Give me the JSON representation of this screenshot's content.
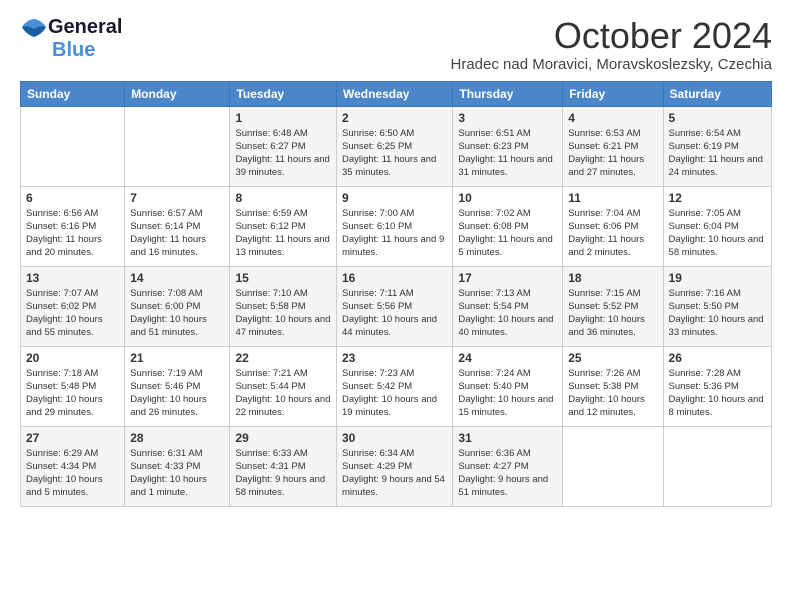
{
  "logo": {
    "line1": "General",
    "line2": "Blue"
  },
  "title": "October 2024",
  "subtitle": "Hradec nad Moravici, Moravskoslezsky, Czechia",
  "headers": [
    "Sunday",
    "Monday",
    "Tuesday",
    "Wednesday",
    "Thursday",
    "Friday",
    "Saturday"
  ],
  "weeks": [
    [
      {
        "day": "",
        "info": ""
      },
      {
        "day": "",
        "info": ""
      },
      {
        "day": "1",
        "info": "Sunrise: 6:48 AM\nSunset: 6:27 PM\nDaylight: 11 hours and 39 minutes."
      },
      {
        "day": "2",
        "info": "Sunrise: 6:50 AM\nSunset: 6:25 PM\nDaylight: 11 hours and 35 minutes."
      },
      {
        "day": "3",
        "info": "Sunrise: 6:51 AM\nSunset: 6:23 PM\nDaylight: 11 hours and 31 minutes."
      },
      {
        "day": "4",
        "info": "Sunrise: 6:53 AM\nSunset: 6:21 PM\nDaylight: 11 hours and 27 minutes."
      },
      {
        "day": "5",
        "info": "Sunrise: 6:54 AM\nSunset: 6:19 PM\nDaylight: 11 hours and 24 minutes."
      }
    ],
    [
      {
        "day": "6",
        "info": "Sunrise: 6:56 AM\nSunset: 6:16 PM\nDaylight: 11 hours and 20 minutes."
      },
      {
        "day": "7",
        "info": "Sunrise: 6:57 AM\nSunset: 6:14 PM\nDaylight: 11 hours and 16 minutes."
      },
      {
        "day": "8",
        "info": "Sunrise: 6:59 AM\nSunset: 6:12 PM\nDaylight: 11 hours and 13 minutes."
      },
      {
        "day": "9",
        "info": "Sunrise: 7:00 AM\nSunset: 6:10 PM\nDaylight: 11 hours and 9 minutes."
      },
      {
        "day": "10",
        "info": "Sunrise: 7:02 AM\nSunset: 6:08 PM\nDaylight: 11 hours and 5 minutes."
      },
      {
        "day": "11",
        "info": "Sunrise: 7:04 AM\nSunset: 6:06 PM\nDaylight: 11 hours and 2 minutes."
      },
      {
        "day": "12",
        "info": "Sunrise: 7:05 AM\nSunset: 6:04 PM\nDaylight: 10 hours and 58 minutes."
      }
    ],
    [
      {
        "day": "13",
        "info": "Sunrise: 7:07 AM\nSunset: 6:02 PM\nDaylight: 10 hours and 55 minutes."
      },
      {
        "day": "14",
        "info": "Sunrise: 7:08 AM\nSunset: 6:00 PM\nDaylight: 10 hours and 51 minutes."
      },
      {
        "day": "15",
        "info": "Sunrise: 7:10 AM\nSunset: 5:58 PM\nDaylight: 10 hours and 47 minutes."
      },
      {
        "day": "16",
        "info": "Sunrise: 7:11 AM\nSunset: 5:56 PM\nDaylight: 10 hours and 44 minutes."
      },
      {
        "day": "17",
        "info": "Sunrise: 7:13 AM\nSunset: 5:54 PM\nDaylight: 10 hours and 40 minutes."
      },
      {
        "day": "18",
        "info": "Sunrise: 7:15 AM\nSunset: 5:52 PM\nDaylight: 10 hours and 36 minutes."
      },
      {
        "day": "19",
        "info": "Sunrise: 7:16 AM\nSunset: 5:50 PM\nDaylight: 10 hours and 33 minutes."
      }
    ],
    [
      {
        "day": "20",
        "info": "Sunrise: 7:18 AM\nSunset: 5:48 PM\nDaylight: 10 hours and 29 minutes."
      },
      {
        "day": "21",
        "info": "Sunrise: 7:19 AM\nSunset: 5:46 PM\nDaylight: 10 hours and 26 minutes."
      },
      {
        "day": "22",
        "info": "Sunrise: 7:21 AM\nSunset: 5:44 PM\nDaylight: 10 hours and 22 minutes."
      },
      {
        "day": "23",
        "info": "Sunrise: 7:23 AM\nSunset: 5:42 PM\nDaylight: 10 hours and 19 minutes."
      },
      {
        "day": "24",
        "info": "Sunrise: 7:24 AM\nSunset: 5:40 PM\nDaylight: 10 hours and 15 minutes."
      },
      {
        "day": "25",
        "info": "Sunrise: 7:26 AM\nSunset: 5:38 PM\nDaylight: 10 hours and 12 minutes."
      },
      {
        "day": "26",
        "info": "Sunrise: 7:28 AM\nSunset: 5:36 PM\nDaylight: 10 hours and 8 minutes."
      }
    ],
    [
      {
        "day": "27",
        "info": "Sunrise: 6:29 AM\nSunset: 4:34 PM\nDaylight: 10 hours and 5 minutes."
      },
      {
        "day": "28",
        "info": "Sunrise: 6:31 AM\nSunset: 4:33 PM\nDaylight: 10 hours and 1 minute."
      },
      {
        "day": "29",
        "info": "Sunrise: 6:33 AM\nSunset: 4:31 PM\nDaylight: 9 hours and 58 minutes."
      },
      {
        "day": "30",
        "info": "Sunrise: 6:34 AM\nSunset: 4:29 PM\nDaylight: 9 hours and 54 minutes."
      },
      {
        "day": "31",
        "info": "Sunrise: 6:36 AM\nSunset: 4:27 PM\nDaylight: 9 hours and 51 minutes."
      },
      {
        "day": "",
        "info": ""
      },
      {
        "day": "",
        "info": ""
      }
    ]
  ]
}
